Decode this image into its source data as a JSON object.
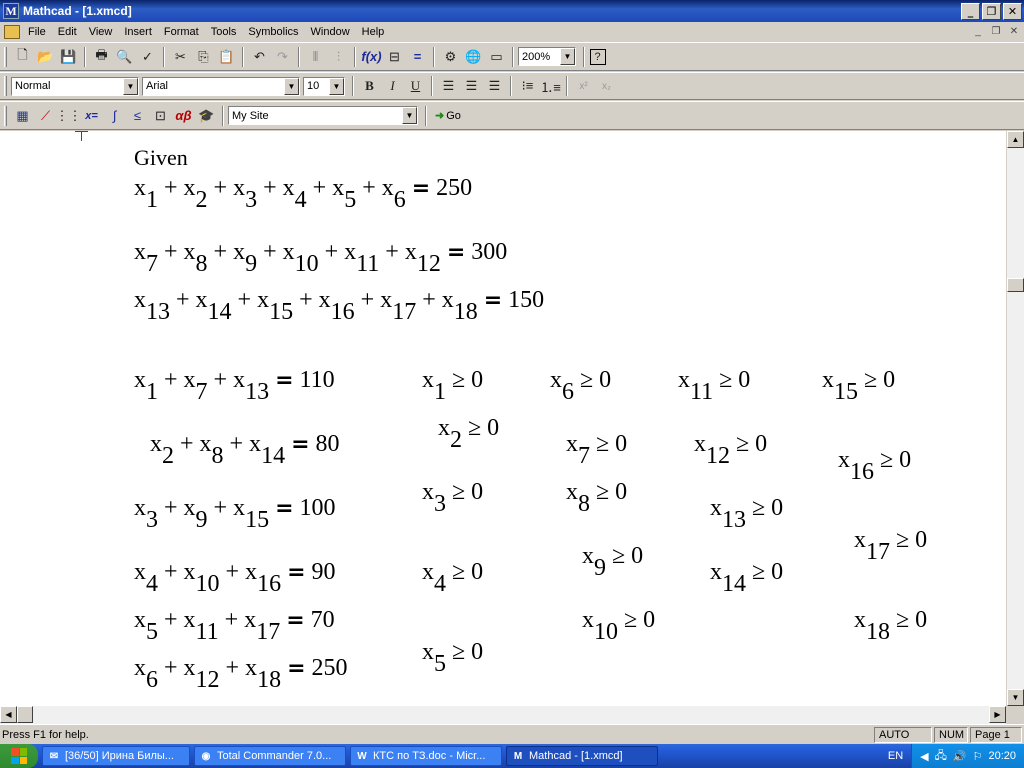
{
  "window": {
    "title": "Mathcad - [1.xmcd]",
    "app_icon": "M"
  },
  "title_buttons": {
    "minimize": "_",
    "restore": "❐",
    "close": "✕"
  },
  "menu": [
    "File",
    "Edit",
    "View",
    "Insert",
    "Format",
    "Tools",
    "Symbolics",
    "Window",
    "Help"
  ],
  "toolbar": {
    "zoom": "200%",
    "style": "Normal",
    "font": "Arial",
    "size": "10",
    "bold": "B",
    "italic": "I",
    "underline": "U",
    "site": "My Site",
    "go": "Go"
  },
  "doc": {
    "given": "Given",
    "eq_sign": "=",
    "ge": "≥",
    "plus": "+",
    "equations": [
      {
        "terms": [
          "1",
          "2",
          "3",
          "4",
          "5",
          "6"
        ],
        "rhs": "250"
      },
      {
        "terms": [
          "7",
          "8",
          "9",
          "10",
          "11",
          "12"
        ],
        "rhs": "300"
      },
      {
        "terms": [
          "13",
          "14",
          "15",
          "16",
          "17",
          "18"
        ],
        "rhs": "150"
      },
      {
        "terms": [
          "1",
          "7",
          "13"
        ],
        "rhs": "110"
      },
      {
        "terms": [
          "2",
          "8",
          "14"
        ],
        "rhs": "80"
      },
      {
        "terms": [
          "3",
          "9",
          "15"
        ],
        "rhs": "100"
      },
      {
        "terms": [
          "4",
          "10",
          "16"
        ],
        "rhs": "90"
      },
      {
        "terms": [
          "5",
          "11",
          "17"
        ],
        "rhs": "70"
      },
      {
        "terms": [
          "6",
          "12",
          "18"
        ],
        "rhs": "250"
      }
    ],
    "constraints": [
      {
        "idx": "1",
        "val": "0"
      },
      {
        "idx": "2",
        "val": "0"
      },
      {
        "idx": "3",
        "val": "0"
      },
      {
        "idx": "4",
        "val": "0"
      },
      {
        "idx": "5",
        "val": "0"
      },
      {
        "idx": "6",
        "val": "0"
      },
      {
        "idx": "7",
        "val": "0"
      },
      {
        "idx": "8",
        "val": "0"
      },
      {
        "idx": "9",
        "val": "0"
      },
      {
        "idx": "10",
        "val": "0"
      },
      {
        "idx": "11",
        "val": "0"
      },
      {
        "idx": "12",
        "val": "0"
      },
      {
        "idx": "13",
        "val": "0"
      },
      {
        "idx": "14",
        "val": "0"
      },
      {
        "idx": "15",
        "val": "0"
      },
      {
        "idx": "16",
        "val": "0"
      },
      {
        "idx": "17",
        "val": "0"
      },
      {
        "idx": "18",
        "val": "0"
      }
    ]
  },
  "status": {
    "help": "Press F1 for help.",
    "mode": "AUTO",
    "num": "NUM",
    "page": "Page 1"
  },
  "taskbar": {
    "tasks": [
      "[36/50] Ирина Билы...",
      "Total Commander 7.0...",
      "КТС по ТЗ.doc - Micr...",
      "Mathcad - [1.xmcd]"
    ],
    "lang": "EN",
    "clock": "20:20"
  }
}
